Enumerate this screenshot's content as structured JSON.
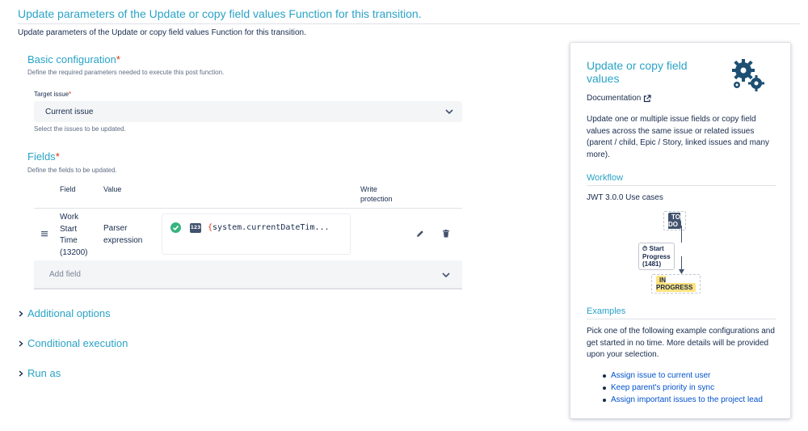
{
  "header": {
    "title": "Update parameters of the Update or copy field values Function for this transition.",
    "subtitle": "Update parameters of the Update or copy field values Function for this transition."
  },
  "basic": {
    "title": "Basic configuration",
    "required_mark": "*",
    "description": "Define the required parameters needed to execute this post function.",
    "target_label": "Target issue",
    "target_value": "Current issue",
    "target_help": "Select the issues to be updated."
  },
  "fields": {
    "title": "Fields",
    "required_mark": "*",
    "description": "Define the fields to be updated.",
    "columns": {
      "field": "Field",
      "value": "Value",
      "write_protection": "Write protection"
    },
    "row": {
      "field": "Work Start Time (13200)",
      "value": "Parser expression",
      "type_badge": "123",
      "expression_open": "{",
      "expression": "system.currentDateTim...",
      "status": "valid"
    },
    "add_field_placeholder": "Add field"
  },
  "collapsibles": {
    "additional": "Additional options",
    "conditional": "Conditional execution",
    "run_as": "Run as"
  },
  "panel": {
    "title": "Update or copy field values",
    "documentation": "Documentation",
    "description": "Update one or multiple issue fields or copy field values across the same issue or related issues (parent / child, Epic / Story, linked issues and many more).",
    "workflow_heading": "Workflow",
    "workflow_caption": "JWT 3.0.0 Use cases",
    "workflow": {
      "from": "TO DO",
      "transition": "Start Progress (1481)",
      "to": "IN PROGRESS"
    },
    "examples_heading": "Examples",
    "examples_intro": "Pick one of the following example configurations and get started in no time. More details will be provided upon your selection.",
    "examples": [
      "Assign issue to current user",
      "Keep parent's priority in sync",
      "Assign important issues to the project lead"
    ]
  },
  "colors": {
    "accent": "#2aa3c6",
    "required": "#de350b",
    "link": "#0052cc",
    "success": "#36b37e"
  }
}
